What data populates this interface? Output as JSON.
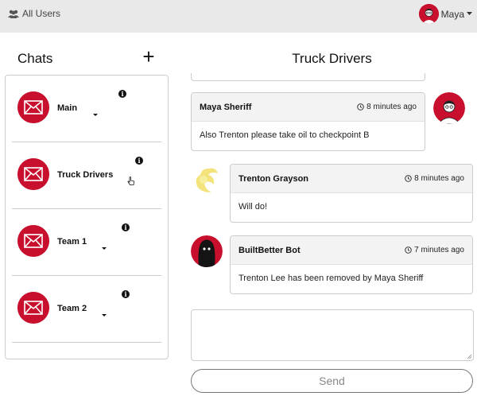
{
  "topbar": {
    "all_users_label": "All Users",
    "user_name": "Maya",
    "icons": [
      "users-icon",
      "avatar",
      "caret-down-icon"
    ]
  },
  "sidebar": {
    "title": "Chats",
    "add_label": "+",
    "chats": [
      {
        "name": "Main",
        "icon": "envelope-icon"
      },
      {
        "name": "Truck Drivers",
        "icon": "envelope-icon"
      },
      {
        "name": "Team 1",
        "icon": "envelope-icon"
      },
      {
        "name": "Team 2",
        "icon": "envelope-icon"
      }
    ]
  },
  "main": {
    "room_title": "Truck Drivers",
    "messages": [
      {
        "author": "Maya Sheriff",
        "time": "8 minutes ago",
        "text": "Also Trenton please take oil to checkpoint B"
      },
      {
        "author": "Trenton Grayson",
        "time": "8 minutes ago",
        "text": "Will do!"
      },
      {
        "author": "BuiltBetter Bot",
        "time": "7 minutes ago",
        "text": "Trenton Lee has been removed by Maya Sheriff"
      }
    ],
    "compose_value": "",
    "send_label": "Send"
  },
  "colors": {
    "brand_red": "#c8102e",
    "topbar_bg": "#e9e9e9",
    "message_header_bg": "#f3f3f3",
    "border": "#cccccc"
  }
}
